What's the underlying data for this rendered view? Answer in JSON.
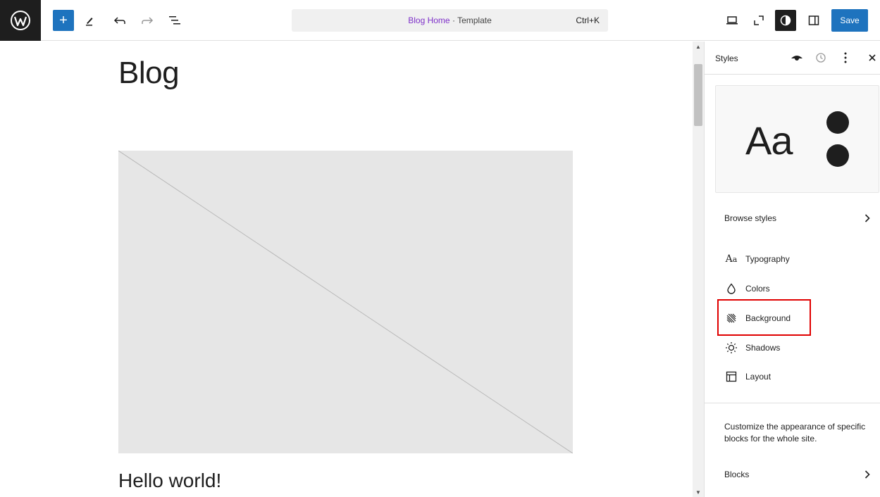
{
  "header": {
    "document_title": "Blog Home",
    "separator": " · ",
    "document_type": "Template",
    "shortcut": "Ctrl+K",
    "save_label": "Save"
  },
  "canvas": {
    "blog_title": "Blog",
    "post_title": "Hello world!"
  },
  "sidebar": {
    "title": "Styles",
    "preview_text": "Aa",
    "browse_styles": "Browse styles",
    "items": [
      {
        "label": "Typography",
        "icon": "typography-icon"
      },
      {
        "label": "Colors",
        "icon": "droplet-icon"
      },
      {
        "label": "Background",
        "icon": "background-icon"
      },
      {
        "label": "Shadows",
        "icon": "shadow-icon"
      },
      {
        "label": "Layout",
        "icon": "layout-icon"
      }
    ],
    "description": "Customize the appearance of specific blocks for the whole site.",
    "blocks_label": "Blocks"
  },
  "colors": {
    "accent": "#1e73be",
    "template_link": "#7e30c9",
    "highlight": "#e00000"
  }
}
